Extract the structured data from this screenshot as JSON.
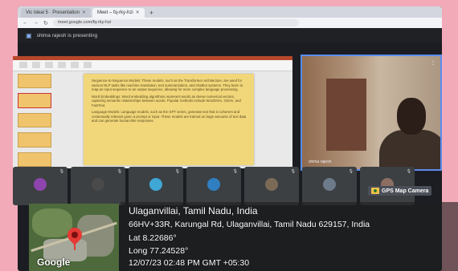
{
  "browser": {
    "tabs": [
      {
        "label": "Vic Ideal 5 · Presentation",
        "active": false
      },
      {
        "label": "Meet – fq-rky-hzi",
        "active": true
      }
    ],
    "url": "meet.google.com/fq-rky-hzi"
  },
  "meet": {
    "presenting_text": "shima rajesh is presenting",
    "camera_name": "shima rajesh"
  },
  "slide": {
    "paragraphs": [
      "Sequence-to-Sequence Models: These models, such as the Transformer architecture, are used for various NLP tasks like machine translation, text summarization, and chatbot systems. They learn to map an input sequence to an output sequence, allowing for more complex language processing.",
      "Word Embeddings: Word embedding algorithms represent words as dense numerical vectors, capturing semantic relationships between words. Popular methods include Word2Vec, GloVe, and FastText.",
      "Language Models: Language models, such as the GPT series, generate text that is coherent and contextually relevant given a prompt or input. These models are trained on large amounts of text data and can generate human-like responses."
    ]
  },
  "participants": [
    {
      "name": "",
      "color": "#8e44ad"
    },
    {
      "name": "",
      "color": "#4a4a4a"
    },
    {
      "name": "",
      "color": "#3fa7d6"
    },
    {
      "name": "",
      "color": "#2f7fc1"
    },
    {
      "name": "",
      "color": "#7a6a56"
    },
    {
      "name": "",
      "color": "#6c7a89"
    },
    {
      "name": "",
      "color": "#8d6e63"
    }
  ],
  "gps": {
    "badge": "GPS Map Camera",
    "title": "Ulaganvillai, Tamil Nadu, India",
    "address": "66HV+33R, Karungal Rd, Ulaganvillai, Tamil Nadu 629157, India",
    "lat": "Lat 8.22686°",
    "long": "Long 77.24528°",
    "timestamp": "12/07/23 02:48 PM GMT +05:30",
    "map_brand": "Google"
  }
}
